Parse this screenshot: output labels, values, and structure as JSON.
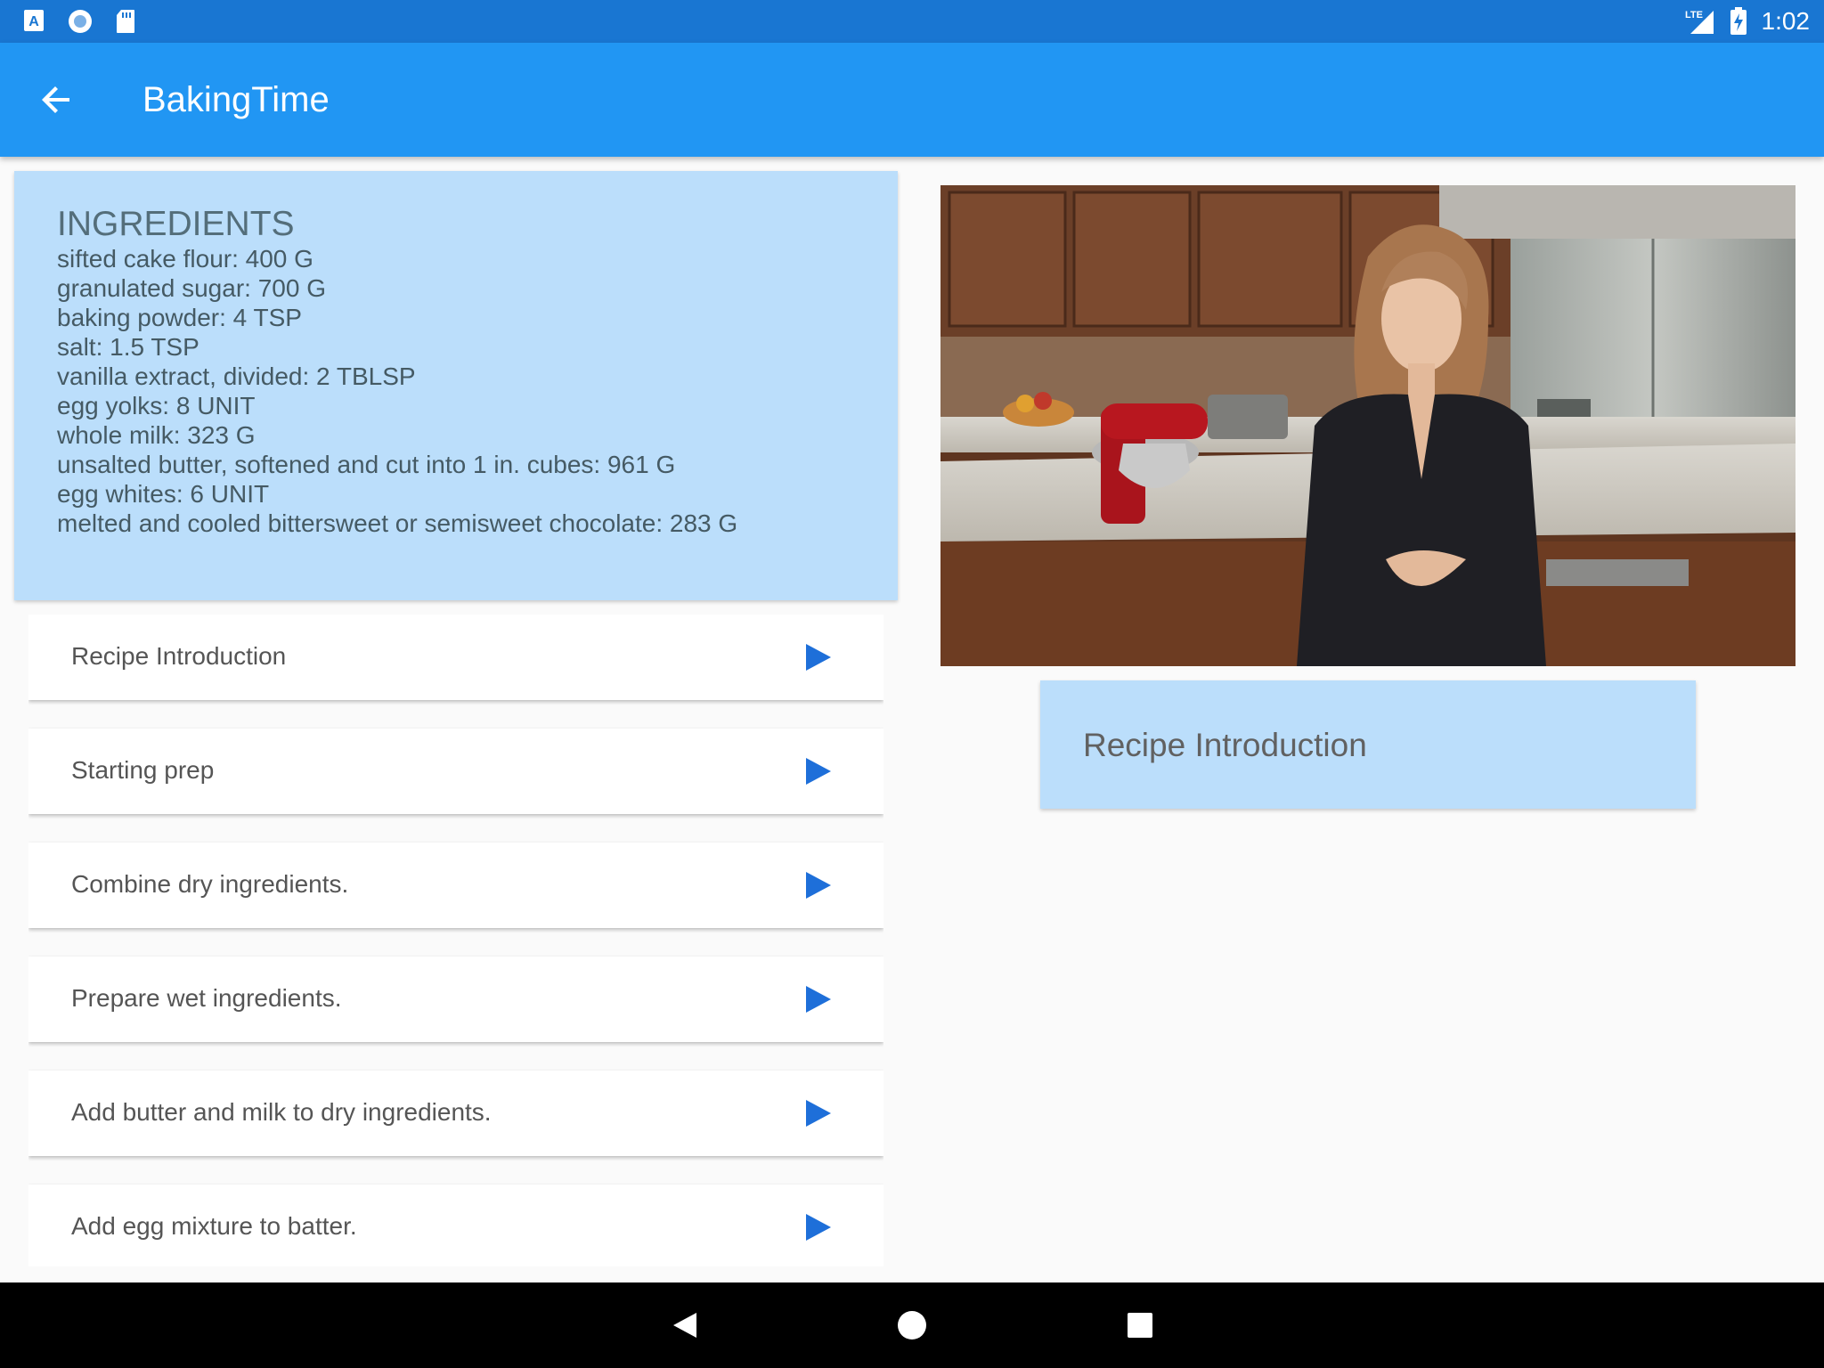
{
  "status_bar": {
    "time": "1:02",
    "network": "LTE",
    "left_icons": [
      "android-a-icon",
      "circle-notification-icon",
      "sd-card-icon"
    ],
    "right_icons": [
      "lte-signal-icon",
      "battery-charging-icon"
    ]
  },
  "app_bar": {
    "title": "BakingTime",
    "back_icon": "arrow-back-icon"
  },
  "ingredients": {
    "title": "INGREDIENTS",
    "items": [
      "sifted cake flour: 400 G",
      "granulated sugar: 700 G",
      "baking powder: 4 TSP",
      "salt: 1.5 TSP",
      "vanilla extract, divided: 2 TBLSP",
      "egg yolks: 8 UNIT",
      "whole milk: 323 G",
      "unsalted butter, softened and cut into 1 in. cubes: 961 G",
      "egg whites: 6 UNIT",
      "melted and cooled bittersweet or semisweet chocolate: 283 G"
    ]
  },
  "steps": [
    {
      "label": "Recipe Introduction"
    },
    {
      "label": "Starting prep"
    },
    {
      "label": "Combine dry ingredients."
    },
    {
      "label": "Prepare wet ingredients."
    },
    {
      "label": "Add butter and milk to dry ingredients."
    },
    {
      "label": "Add egg mixture to batter."
    }
  ],
  "selected_step": {
    "label": "Recipe Introduction"
  },
  "colors": {
    "status_bar": "#1976d2",
    "app_bar": "#2196f3",
    "card_highlight": "#bbdefb",
    "play_icon": "#1e6fd9"
  },
  "nav_bar": {
    "icons": [
      "back-triangle-icon",
      "home-circle-icon",
      "recents-square-icon"
    ]
  }
}
